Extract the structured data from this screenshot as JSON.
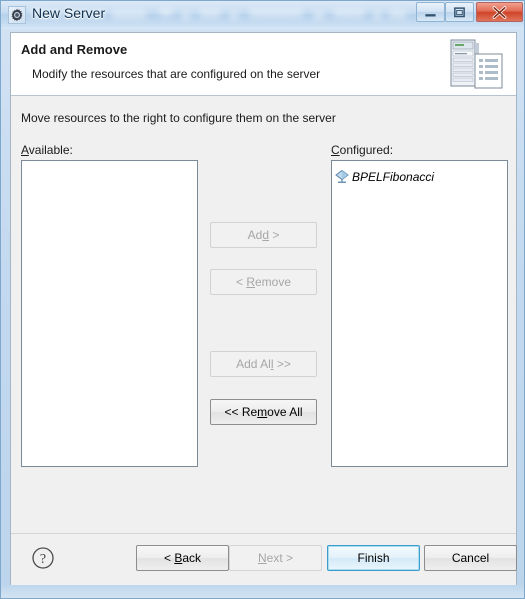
{
  "window": {
    "title": "New Server",
    "app_icon": "gear-icon",
    "controls": {
      "minimize": "Minimize",
      "maximize": "Maximize",
      "close": "Close"
    }
  },
  "header": {
    "title": "Add and Remove",
    "description": "Modify the resources that are configured on the server",
    "icon": "server-and-document-icon"
  },
  "body": {
    "instruction": "Move resources to the right to configure them on the server",
    "available": {
      "label_prefix": "",
      "label_mnemonic": "A",
      "label_suffix": "vailable:",
      "items": []
    },
    "configured": {
      "label_mnemonic": "C",
      "label_suffix": "onfigured:",
      "items": [
        {
          "name": "BPELFibonacci",
          "icon": "bpel-process-icon"
        }
      ]
    },
    "transfer_buttons": [
      {
        "id": "add",
        "prefix": "Ad",
        "mnemonic": "d",
        "suffix": " >",
        "enabled": false
      },
      {
        "id": "remove",
        "prefix": "< ",
        "mnemonic": "R",
        "suffix": "emove",
        "enabled": false
      },
      {
        "id": "add_all",
        "prefix": "Add Al",
        "mnemonic": "l",
        "suffix": " >>",
        "enabled": false
      },
      {
        "id": "remove_all",
        "prefix": "<< Re",
        "mnemonic": "m",
        "suffix": "ove All",
        "enabled": true
      }
    ]
  },
  "footer": {
    "help": "?",
    "buttons": [
      {
        "id": "back",
        "prefix": "< ",
        "mnemonic": "B",
        "suffix": "ack",
        "state": "enabled"
      },
      {
        "id": "next",
        "prefix": "",
        "mnemonic": "N",
        "suffix": "ext >",
        "state": "disabled"
      },
      {
        "id": "finish",
        "prefix": "Finish",
        "mnemonic": "",
        "suffix": "",
        "state": "default"
      },
      {
        "id": "cancel",
        "prefix": "Cancel",
        "mnemonic": "",
        "suffix": "",
        "state": "enabled"
      }
    ]
  },
  "colors": {
    "titlebar_text": "#10314f",
    "close_button": "#cf4428",
    "default_button_border": "#3c9ccc",
    "dialog_background": "#f0f0f0",
    "header_background": "#ffffff",
    "disabled_text": "#a6a6a6"
  }
}
